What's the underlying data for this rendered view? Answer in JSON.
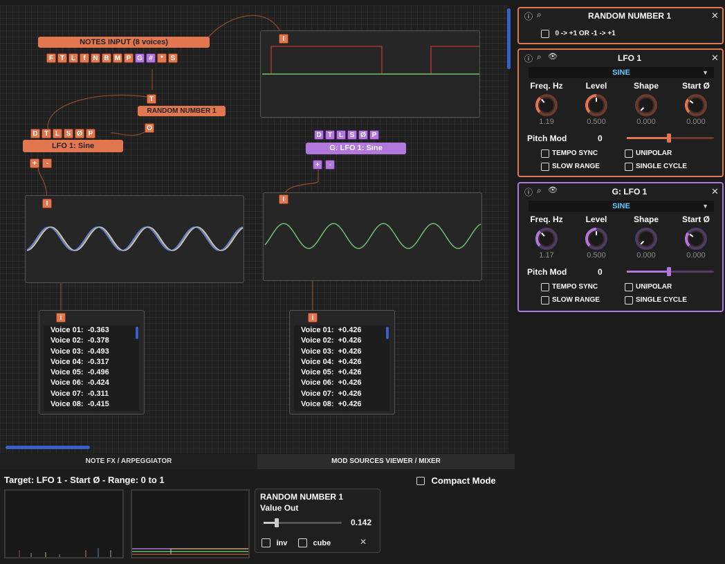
{
  "canvas": {
    "notes_input": {
      "title": "NOTES INPUT  (8 voices)",
      "ports": [
        "F",
        "T",
        "L",
        "f",
        "N",
        "B",
        "M",
        "P",
        "G",
        "#",
        "*",
        "S"
      ]
    },
    "random_node": {
      "in_port": "T",
      "title": "RANDOM NUMBER 1",
      "out_port": "O"
    },
    "lfo1_node": {
      "ports": [
        "D",
        "T",
        "L",
        "S",
        "Ø",
        "P"
      ],
      "title": "LFO 1: Sine",
      "plus": "+",
      "minus": "-"
    },
    "glfo1_node": {
      "ports": [
        "D",
        "T",
        "L",
        "S",
        "Ø",
        "P"
      ],
      "title": "G: LFO 1: Sine",
      "plus": "+",
      "minus": "-"
    },
    "scope_top": {
      "port": "I"
    },
    "scope_left": {
      "port": "I"
    },
    "scope_right": {
      "port": "I"
    },
    "values_left": {
      "port": "i",
      "lines": [
        "Voice 01:  -0.363",
        "Voice 02:  -0.378",
        "Voice 03:  -0.493",
        "Voice 04:  -0.317",
        "Voice 05:  -0.496",
        "Voice 06:  -0.424",
        "Voice 07:  -0.311",
        "Voice 08:  -0.415"
      ]
    },
    "values_right": {
      "port": "i",
      "lines": [
        "Voice 01:  +0.426",
        "Voice 02:  +0.426",
        "Voice 03:  +0.426",
        "Voice 04:  +0.426",
        "Voice 05:  +0.426",
        "Voice 06:  +0.426",
        "Voice 07:  +0.426",
        "Voice 08:  +0.426"
      ]
    }
  },
  "panels": {
    "random": {
      "info_icon": "ⓘ",
      "search_icon": "⌕",
      "title": "RANDOM NUMBER 1",
      "close": "✕",
      "option": "0 -> +1 OR -1 -> +1"
    },
    "lfo1": {
      "info_icon": "ⓘ",
      "search_icon": "⌕",
      "eye_icon": "👁",
      "title": "LFO 1",
      "close": "✕",
      "waveform": "SINE",
      "knobs": [
        {
          "label": "Freq. Hz",
          "value": "1.19",
          "level": 0.35
        },
        {
          "label": "Level",
          "value": "0.500",
          "level": 0.5
        },
        {
          "label": "Shape",
          "value": "0.000",
          "level": 0.0
        },
        {
          "label": "Start Ø",
          "value": "0.000",
          "level": 0.3
        }
      ],
      "pitch_mod_label": "Pitch Mod",
      "pitch_mod_value": "0",
      "checks": [
        "TEMPO SYNC",
        "UNIPOLAR",
        "SLOW RANGE",
        "SINGLE CYCLE"
      ],
      "accent": "#e2764f"
    },
    "glfo1": {
      "info_icon": "ⓘ",
      "search_icon": "⌕",
      "eye_icon": "👁",
      "title": "G: LFO 1",
      "close": "✕",
      "waveform": "SINE",
      "knobs": [
        {
          "label": "Freq. Hz",
          "value": "1.17",
          "level": 0.35
        },
        {
          "label": "Level",
          "value": "0.500",
          "level": 0.5
        },
        {
          "label": "Shape",
          "value": "0.000",
          "level": 0.0
        },
        {
          "label": "Start Ø",
          "value": "0.000",
          "level": 0.3
        }
      ],
      "pitch_mod_label": "Pitch Mod",
      "pitch_mod_value": "0",
      "checks": [
        "TEMPO SYNC",
        "UNIPOLAR",
        "SLOW RANGE",
        "SINGLE CYCLE"
      ],
      "accent": "#b277dd"
    }
  },
  "bottom": {
    "tabs": [
      "NOTE FX / ARPEGGIATOR",
      "MOD SOURCES VIEWER / MIXER"
    ],
    "target": "Target: LFO 1 - Start Ø - Range: 0 to 1",
    "compact_mode": "Compact Mode",
    "mixer": {
      "title": "RANDOM NUMBER 1",
      "subtitle": "Value Out",
      "value": "0.142",
      "inv": "inv",
      "cube": "cube",
      "close": "✕"
    }
  },
  "colors": {
    "orange": "#e2764f",
    "purple": "#b277dd",
    "green": "#6cc26c",
    "blue_accent": "#5ec8ff"
  }
}
